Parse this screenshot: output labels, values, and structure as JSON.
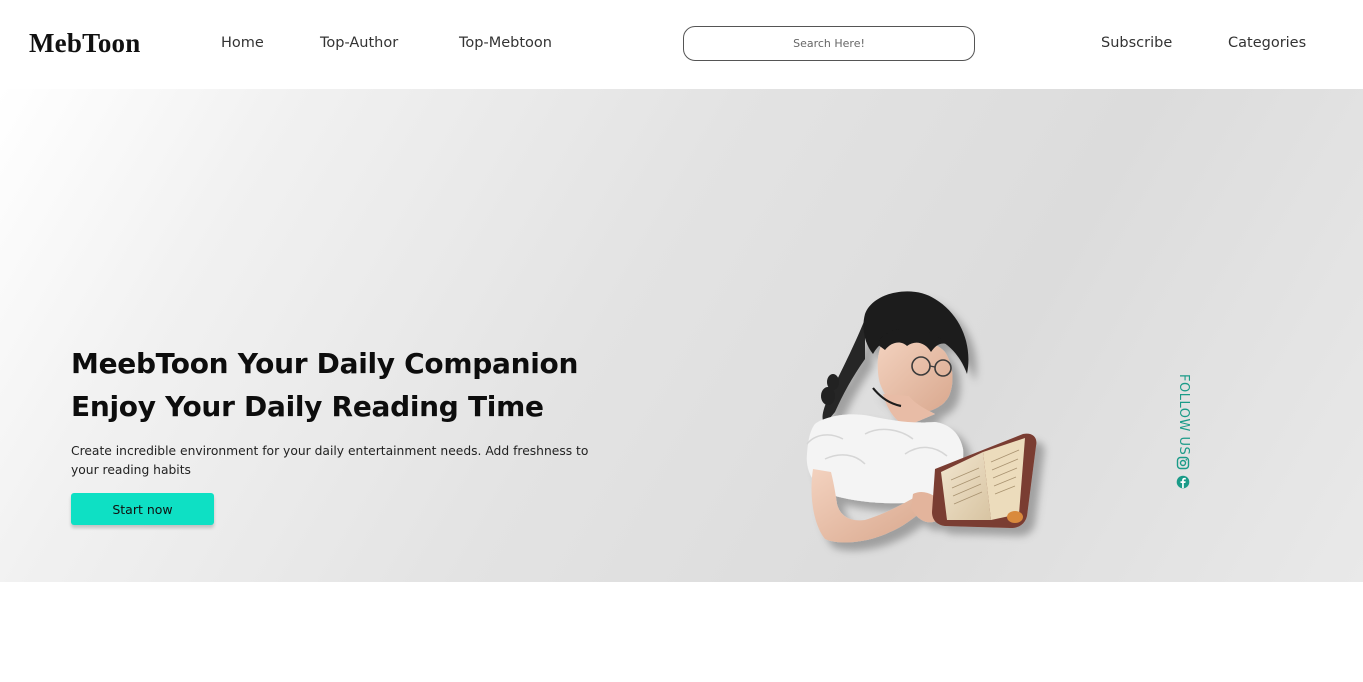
{
  "brand": {
    "logo": "MebToon"
  },
  "nav": {
    "home": "Home",
    "top_author": "Top-Author",
    "top_mebtoon": "Top-Mebtoon",
    "subscribe": "Subscribe",
    "categories": "Categories"
  },
  "search": {
    "placeholder": "Search Here!",
    "value": ""
  },
  "hero": {
    "title_line1": "MeebToon Your Daily Companion",
    "title_line2": "Enjoy Your Daily Reading Time",
    "description": "Create incredible environment for your daily entertainment needs. Add freshness to your reading habits",
    "cta_label": "Start now"
  },
  "social": {
    "follow_label": "FOLLOW US",
    "icons": [
      "instagram-icon",
      "facebook-icon"
    ]
  },
  "colors": {
    "accent": "#0ee0c4",
    "follow_teal": "#1a9b88",
    "hero_bg": "#e0e0e0"
  }
}
